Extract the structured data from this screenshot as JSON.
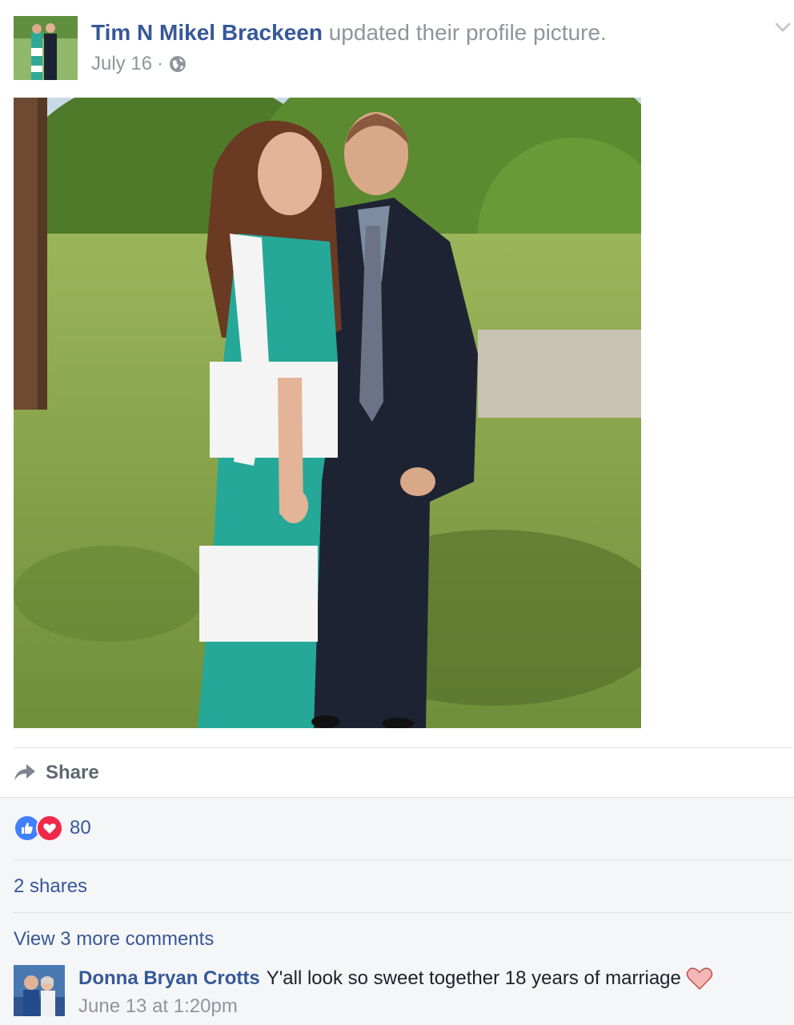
{
  "post": {
    "author": "Tim N Mikel Brackeen",
    "action_text": "updated their profile picture.",
    "date": "July 16",
    "separator": "·",
    "privacy_icon": "globe-icon",
    "menu_icon": "chevron-down-icon"
  },
  "actions": {
    "share_label": "Share",
    "share_icon": "share-arrow-icon"
  },
  "stats": {
    "reaction_icons": [
      "like-icon",
      "love-icon"
    ],
    "reaction_count": "80",
    "shares_text": "2 shares"
  },
  "comments": {
    "view_more": "View 3 more comments",
    "items": [
      {
        "author": "Donna Bryan Crotts",
        "text": "Y'all look so sweet together 18 years of marriage",
        "emoji": "heart-emoji-icon",
        "time": "June 13 at 1:20pm"
      }
    ]
  },
  "colors": {
    "link_blue": "#365899",
    "meta_gray": "#90949c",
    "like_blue": "#4080ff",
    "love_red": "#f0284a",
    "lower_bg": "#f5f6f7"
  }
}
